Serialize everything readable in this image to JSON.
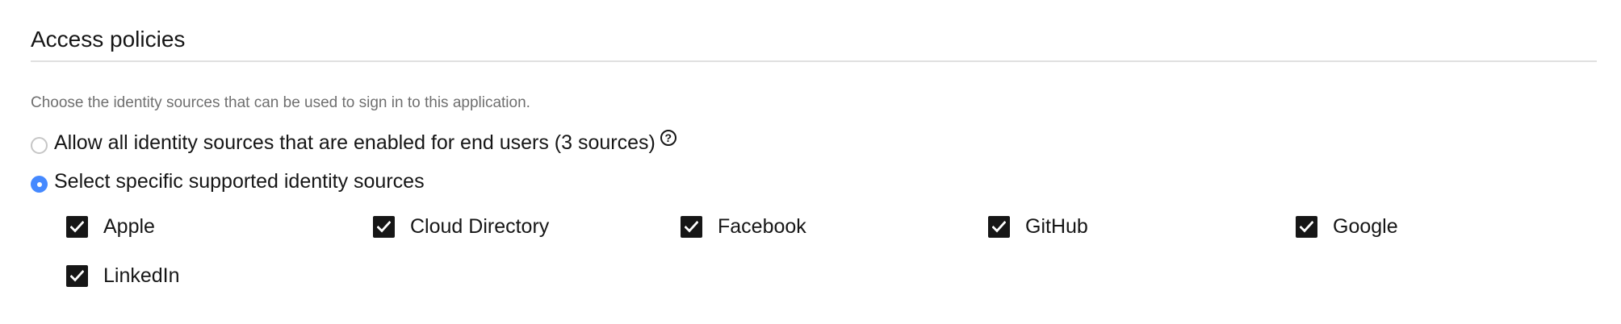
{
  "section": {
    "title": "Access policies",
    "helper_text": "Choose the identity sources that can be used to sign in to this application."
  },
  "radios": [
    {
      "label": "Allow all identity sources that are enabled for end users (3 sources)",
      "checked": false
    },
    {
      "label": "Select specific supported identity sources",
      "checked": true
    }
  ],
  "help_icon": {
    "glyph": "?",
    "name": "help-icon"
  },
  "identity_sources": [
    {
      "label": "Apple",
      "checked": true
    },
    {
      "label": "Cloud Directory",
      "checked": true
    },
    {
      "label": "Facebook",
      "checked": true
    },
    {
      "label": "GitHub",
      "checked": true
    },
    {
      "label": "Google",
      "checked": true
    },
    {
      "label": "LinkedIn",
      "checked": true
    }
  ],
  "colors": {
    "radio_selected": "#4589ff",
    "checkbox_fill": "#161616",
    "helper_text": "#6f6f6f",
    "divider": "#e0e0e0"
  }
}
